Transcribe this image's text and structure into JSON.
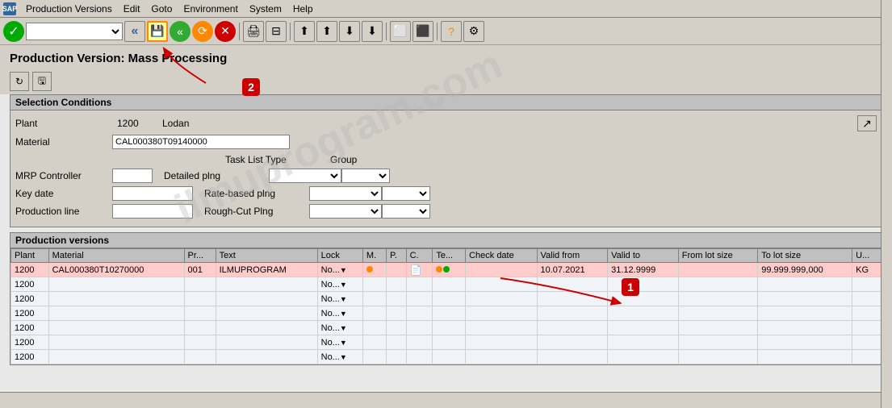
{
  "window": {
    "title": "Production Versions"
  },
  "menubar": {
    "app_icon": "SAP",
    "menus": [
      "Production Versions",
      "Edit",
      "Goto",
      "Environment",
      "System",
      "Help"
    ]
  },
  "toolbar": {
    "select_placeholder": "",
    "buttons": [
      "back",
      "back2",
      "forward",
      "cancel",
      "print1",
      "print2",
      "first",
      "prev",
      "next",
      "last",
      "save_local",
      "multi",
      "help",
      "config"
    ]
  },
  "page": {
    "title": "Production Version: Mass Processing",
    "page_toolbar_buttons": [
      "refresh",
      "local_file"
    ]
  },
  "selection_conditions": {
    "header": "Selection Conditions",
    "fields": {
      "plant_label": "Plant",
      "plant_value": "1200",
      "plant_name": "Lodan",
      "material_label": "Material",
      "material_value": "CAL000380T09140000",
      "mrp_controller_label": "MRP Controller",
      "key_date_label": "Key date",
      "production_line_label": "Production line"
    },
    "task_list": {
      "header_type": "Task List Type",
      "header_group": "Group",
      "rows": [
        {
          "label": "Detailed plng"
        },
        {
          "label": "Rate-based plng"
        },
        {
          "label": "Rough-Cut Plng"
        }
      ]
    }
  },
  "production_versions": {
    "header": "Production versions",
    "columns": [
      "Plant",
      "Material",
      "Pr...",
      "Text",
      "Lock",
      "M.",
      "P.",
      "C.",
      "Te...",
      "Check date",
      "Valid from",
      "Valid to",
      "From lot size",
      "To lot size",
      "U..."
    ],
    "rows": [
      {
        "plant": "1200",
        "material": "CAL000380T10270000",
        "pr": "001",
        "text": "ILMUPROGRAM",
        "lock": "No...",
        "m": "",
        "p": "",
        "c": "",
        "te": "",
        "check_date": "",
        "valid_from": "10.07.2021",
        "valid_to": "31.12.9999",
        "from_lot_size": "",
        "to_lot_size": "99.999.999,000",
        "u": "KG",
        "highlighted": true
      },
      {
        "plant": "1200",
        "material": "",
        "pr": "",
        "text": "",
        "lock": "No...",
        "highlighted": false
      },
      {
        "plant": "1200",
        "material": "",
        "pr": "",
        "text": "",
        "lock": "No...",
        "highlighted": false
      },
      {
        "plant": "1200",
        "material": "",
        "pr": "",
        "text": "",
        "lock": "No...",
        "highlighted": false
      },
      {
        "plant": "1200",
        "material": "",
        "pr": "",
        "text": "",
        "lock": "No...",
        "highlighted": false
      },
      {
        "plant": "1200",
        "material": "",
        "pr": "",
        "text": "",
        "lock": "No...",
        "highlighted": false
      },
      {
        "plant": "1200",
        "material": "",
        "pr": "",
        "text": "",
        "lock": "No...",
        "highlighted": false
      }
    ]
  },
  "annotations": {
    "bubble_1": "1",
    "bubble_2": "2"
  },
  "watermark": "ilmuprogram.com"
}
